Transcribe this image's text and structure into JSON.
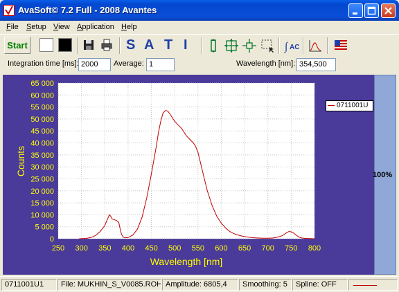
{
  "window": {
    "title": "AvaSoft© 7.2 Full - 2008 Avantes",
    "colors": {
      "titlebar": "#0548d0",
      "close": "#c9391b"
    }
  },
  "menu": [
    "File",
    "Setup",
    "View",
    "Application",
    "Help"
  ],
  "toolbar": {
    "start_label": "Start",
    "sati": [
      "S",
      "A",
      "T",
      "I"
    ],
    "icons": [
      "save-icon",
      "print-icon",
      "autoscale-y-icon",
      "zoom-fit-icon",
      "zoom-out-icon",
      "zoom-select-icon",
      "function-icon",
      "spectrum-icon",
      "flag-icon"
    ]
  },
  "params": {
    "integration_label": "Integration time [ms]:",
    "integration_value": "2000",
    "average_label": "Average:",
    "average_value": "1",
    "wavelength_label": "Wavelength [nm]:",
    "wavelength_value": "354,500"
  },
  "chart_data": {
    "type": "line",
    "xlabel": "Wavelength [nm]",
    "ylabel": "Counts",
    "xlim": [
      250,
      800
    ],
    "ylim": [
      0,
      65000
    ],
    "x_ticks": [
      "250",
      "300",
      "350",
      "400",
      "450",
      "500",
      "550",
      "600",
      "650",
      "700",
      "750",
      "800"
    ],
    "y_ticks": [
      "0",
      "5 000",
      "10 000",
      "15 000",
      "20 000",
      "25 000",
      "30 000",
      "35 000",
      "40 000",
      "45 000",
      "50 000",
      "55 000",
      "60 000",
      "65 000"
    ],
    "grid": true,
    "legend_position": "right",
    "series": [
      {
        "name": "0711001U",
        "color": "#c00000",
        "x": [
          295,
          310,
          320,
          330,
          340,
          350,
          355,
          360,
          363,
          366,
          370,
          375,
          380,
          383,
          386,
          390,
          395,
          400,
          410,
          420,
          430,
          440,
          450,
          460,
          465,
          470,
          475,
          480,
          485,
          490,
          495,
          500,
          505,
          510,
          515,
          520,
          525,
          530,
          535,
          540,
          545,
          550,
          555,
          560,
          570,
          580,
          590,
          600,
          610,
          620,
          630,
          640,
          650,
          660,
          670,
          680,
          690,
          700,
          710,
          720,
          730,
          735,
          740,
          745,
          750,
          755,
          760,
          765,
          770,
          780,
          790,
          800
        ],
        "y": [
          0,
          150,
          500,
          1300,
          3000,
          5500,
          7800,
          10000,
          9300,
          8200,
          8000,
          7600,
          6800,
          4000,
          1800,
          600,
          400,
          500,
          1500,
          4000,
          9000,
          17000,
          27000,
          38000,
          44000,
          49000,
          52500,
          53500,
          53300,
          52000,
          50500,
          49000,
          48000,
          47000,
          46000,
          44500,
          43000,
          42000,
          41000,
          40000,
          38500,
          36000,
          32000,
          28000,
          20000,
          14000,
          9500,
          6500,
          4300,
          2800,
          1900,
          1300,
          900,
          600,
          400,
          300,
          200,
          200,
          300,
          600,
          1200,
          1800,
          2500,
          3000,
          2900,
          2400,
          1600,
          900,
          400,
          150,
          50,
          0
        ]
      }
    ]
  },
  "gauge": {
    "label": "100%"
  },
  "status": {
    "spectrum": "0711001U1",
    "file": "File: MUKHIN_S_V0085.ROH",
    "amplitude": "Amplitude: 6805,4",
    "smoothing": "Smoothing: 5",
    "spline": "Spline: OFF"
  }
}
